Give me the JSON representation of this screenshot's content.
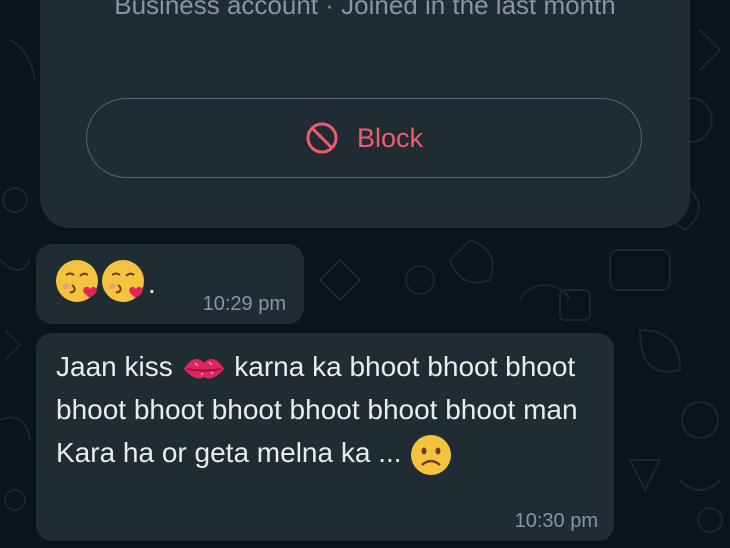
{
  "contact_info": {
    "subtitle": "Business account · Joined in the last month",
    "block_label": "Block"
  },
  "messages": [
    {
      "text_after_emoji": ".",
      "time": "10:29 pm"
    },
    {
      "text_part1": "Jaan kiss ",
      "text_part2": " karna  ka bhoot bhoot bhoot bhoot bhoot bhoot bhoot bhoot bhoot man Kara ha or geta melna ka ...",
      "time": "10:30 pm"
    }
  ],
  "colors": {
    "background": "#0b141a",
    "bubble": "#1f2c34",
    "danger": "#f15c6d",
    "text_primary": "#e9edef",
    "text_secondary": "#8696a0"
  }
}
